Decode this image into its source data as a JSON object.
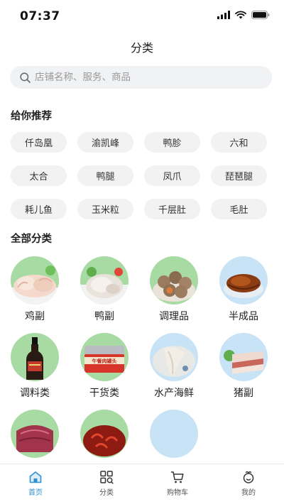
{
  "status": {
    "time": "07:37"
  },
  "page": {
    "title": "分类"
  },
  "search": {
    "placeholder": "店铺名称、服务、商品"
  },
  "recommend": {
    "title": "给你推荐",
    "items": [
      "仟岛凰",
      "渝凯峰",
      "鸭胗",
      "六和",
      "太合",
      "鸭腿",
      "凤爪",
      "琵琶腿",
      "耗儿鱼",
      "玉米粒",
      "千层肚",
      "毛肚"
    ]
  },
  "categories": {
    "title": "全部分类",
    "items": [
      {
        "label": "鸡副",
        "icon": "chicken-feet-image"
      },
      {
        "label": "鸭副",
        "icon": "duck-parts-image"
      },
      {
        "label": "调理品",
        "icon": "meatballs-image"
      },
      {
        "label": "半成品",
        "icon": "braised-meat-image"
      },
      {
        "label": "调料类",
        "icon": "soy-sauce-bottle-image"
      },
      {
        "label": "干货类",
        "icon": "canned-luncheon-meat-image"
      },
      {
        "label": "水产海鲜",
        "icon": "fish-fillet-image"
      },
      {
        "label": "猪副",
        "icon": "pork-belly-image"
      },
      {
        "label": "",
        "icon": "raw-meat-image"
      },
      {
        "label": "",
        "icon": "crayfish-hotpot-image"
      },
      {
        "label": "",
        "icon": "placeholder-image"
      }
    ]
  },
  "tabs": [
    {
      "label": "首页",
      "icon": "home-icon",
      "active": true
    },
    {
      "label": "分类",
      "icon": "category-grid-icon",
      "active": false
    },
    {
      "label": "购物车",
      "icon": "cart-icon",
      "active": false
    },
    {
      "label": "我的",
      "icon": "profile-icon",
      "active": false
    }
  ],
  "colors": {
    "accent": "#2f8fd1",
    "chip_bg": "#f2f2f2",
    "search_bg": "#f1f2f4",
    "image_green": "#a8dba3",
    "image_blue": "#c9e3f6"
  }
}
